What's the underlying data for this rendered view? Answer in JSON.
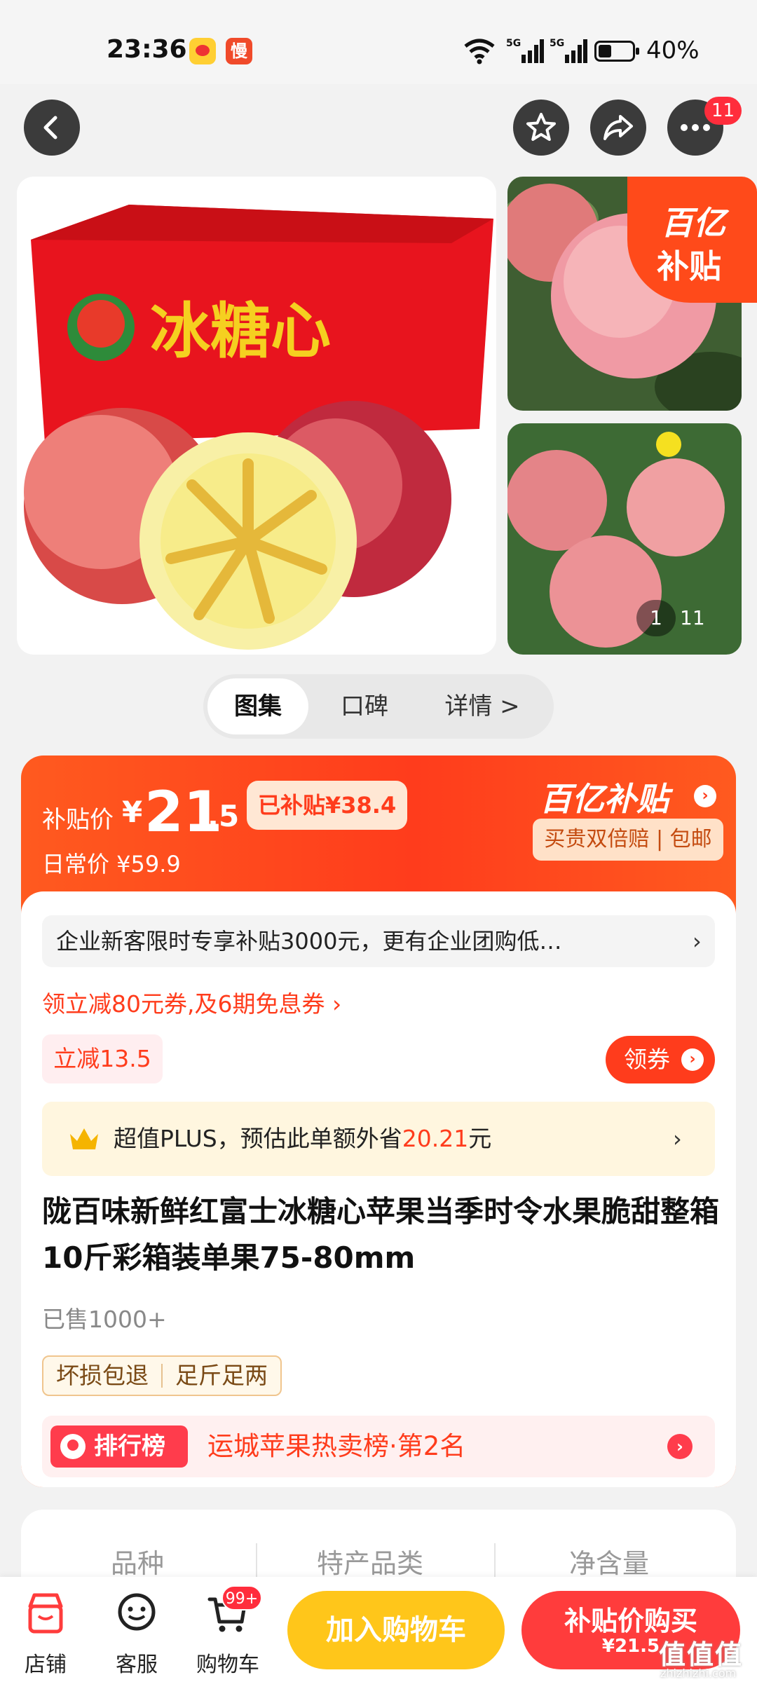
{
  "status_bar": {
    "time": "23:36",
    "app_badge": "慢",
    "network": "5G",
    "battery": "40%"
  },
  "nav": {
    "badge_count": "11"
  },
  "gallery": {
    "side_badge_line1": "百亿",
    "side_badge_line2": "补贴",
    "current": "1",
    "total": "11"
  },
  "tabs": [
    {
      "label": "图集"
    },
    {
      "label": "口碑"
    },
    {
      "label": "详情 >"
    }
  ],
  "price": {
    "label": "补贴价",
    "currency": "¥",
    "integer": "21",
    "decimal": ".5",
    "subsidy": "已补贴¥38.4",
    "daily": "日常价 ¥59.9",
    "program": "百亿补贴",
    "guarantee": "买贵双倍赔 | 包邮"
  },
  "promo": {
    "enterprise": "企业新客限时专享补贴3000元，更有企业团购低…",
    "coupon_link": "领立减80元券,及6期免息券 ›",
    "discount_tag": "立减13.5",
    "coupon_button": "领券"
  },
  "plus": {
    "text_before": "超值PLUS，预估此单额外省",
    "save": "20.21",
    "text_after": "元"
  },
  "product": {
    "title": "陇百味新鲜红富士冰糖心苹果当季时令水果脆甜整箱 10斤彩箱装单果75-80mm",
    "sold": "已售1000+",
    "tags": [
      "坏损包退",
      "足斤足两"
    ]
  },
  "ranking": {
    "badge": "排行榜",
    "text": "运城苹果热卖榜·第2名"
  },
  "specs": [
    "品种",
    "特产品类",
    "净含量"
  ],
  "bottom_bar": {
    "store": "店铺",
    "service": "客服",
    "cart": "购物车",
    "cart_badge": "99+",
    "add_to_cart": "加入购物车",
    "buy_line1": "补贴价购买",
    "buy_line2": "¥21.5"
  },
  "watermark": {
    "text": "值值值",
    "url": "zhizhizhi.com"
  },
  "colors": {
    "accent": "#ff3c1c",
    "cart_button": "#ffc61a",
    "buy_button": "#ff3c3c"
  }
}
